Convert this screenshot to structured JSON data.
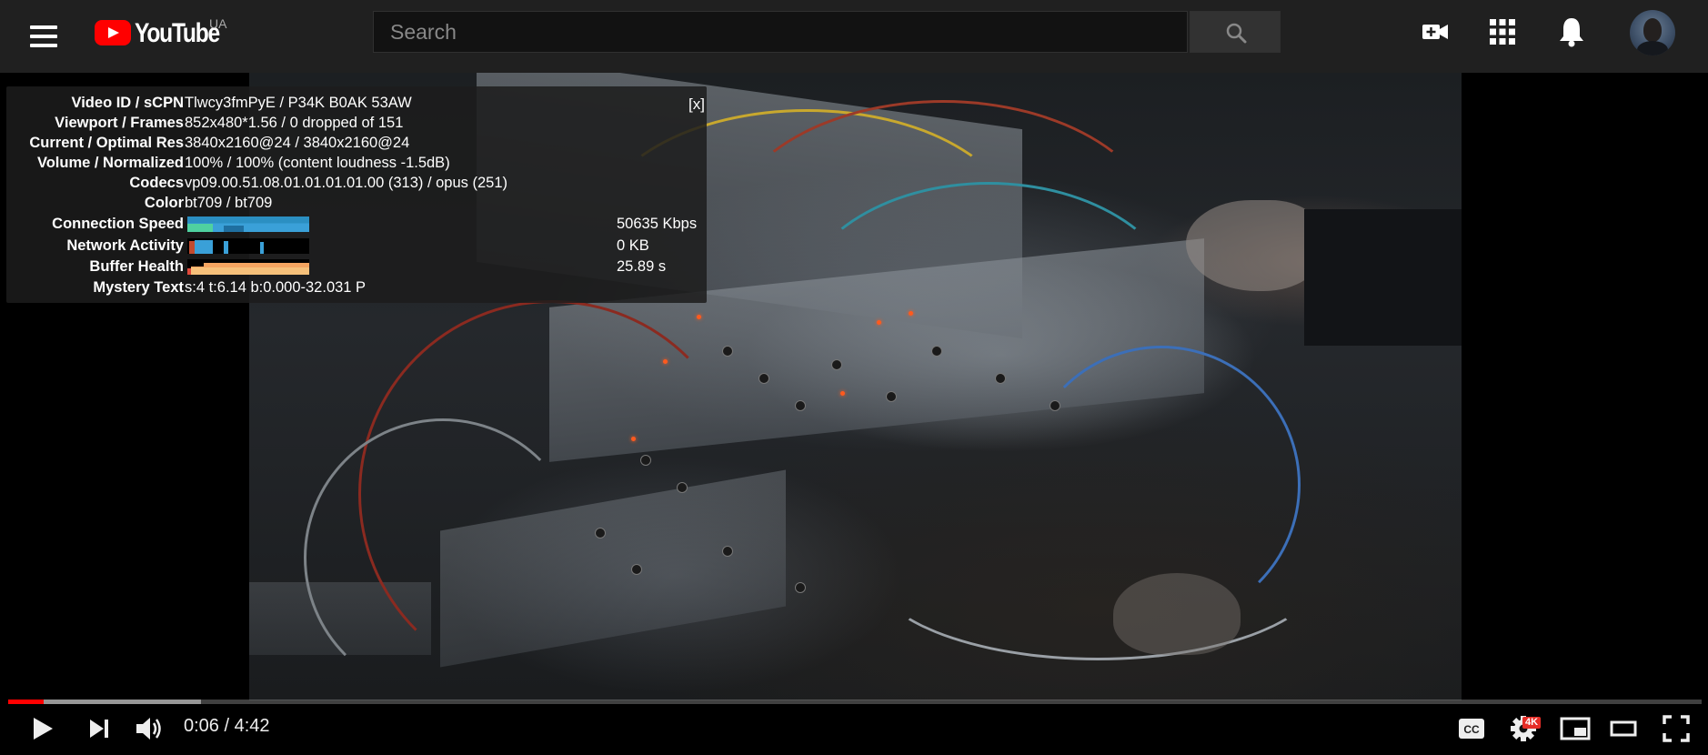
{
  "header": {
    "logo_text": "YouTube",
    "region": "UA",
    "search_placeholder": "Search"
  },
  "stats": {
    "close_label": "[x]",
    "rows": [
      {
        "label": "Video ID / sCPN",
        "value": "Tlwcy3fmPyE / P34K B0AK 53AW"
      },
      {
        "label": "Viewport / Frames",
        "value": "852x480*1.56 / 0 dropped of 151"
      },
      {
        "label": "Current / Optimal Res",
        "value": "3840x2160@24 / 3840x2160@24"
      },
      {
        "label": "Volume / Normalized",
        "value": "100% / 100% (content loudness -1.5dB)"
      },
      {
        "label": "Codecs",
        "value": "vp09.00.51.08.01.01.01.01.00 (313) / opus (251)"
      },
      {
        "label": "Color",
        "value": "bt709 / bt709"
      },
      {
        "label": "Connection Speed",
        "side": "50635 Kbps"
      },
      {
        "label": "Network Activity",
        "side": "0 KB"
      },
      {
        "label": "Buffer Health",
        "side": "25.89 s"
      },
      {
        "label": "Mystery Text",
        "value": "s:4 t:6.14 b:0.000-32.031 P"
      }
    ]
  },
  "player": {
    "time": "0:06 / 4:42",
    "played_fraction": 0.021,
    "buffered_fraction": 0.114,
    "quality_badge": "4K"
  },
  "colors": {
    "brand_red": "#ff0000",
    "topbar_bg": "#202020"
  }
}
